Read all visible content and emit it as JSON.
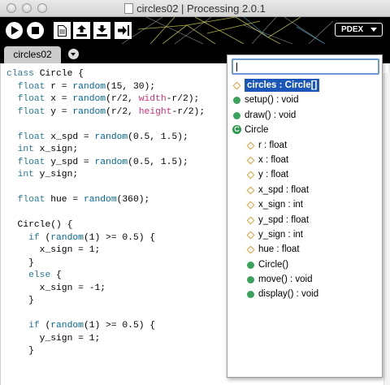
{
  "window": {
    "title": "circles02 | Processing 2.0.1"
  },
  "toolbar": {
    "mode_label": "PDEX"
  },
  "tabs": [
    {
      "label": "circles02"
    }
  ],
  "code": {
    "lines": [
      [
        [
          "class ",
          "kw"
        ],
        [
          "Circle {",
          ""
        ]
      ],
      [
        [
          "  ",
          ""
        ],
        [
          "float",
          "kw"
        ],
        [
          " r = ",
          ""
        ],
        [
          "random",
          "fn"
        ],
        [
          "(15, 30);",
          ""
        ]
      ],
      [
        [
          "  ",
          ""
        ],
        [
          "float",
          "kw"
        ],
        [
          " x = ",
          ""
        ],
        [
          "random",
          "fn"
        ],
        [
          "(r/2, ",
          ""
        ],
        [
          "width",
          "rd"
        ],
        [
          "-r/2);",
          ""
        ]
      ],
      [
        [
          "  ",
          ""
        ],
        [
          "float",
          "kw"
        ],
        [
          " y = ",
          ""
        ],
        [
          "random",
          "fn"
        ],
        [
          "(r/2, ",
          ""
        ],
        [
          "height",
          "rd"
        ],
        [
          "-r/2);",
          ""
        ]
      ],
      [
        [
          "",
          ""
        ]
      ],
      [
        [
          "  ",
          ""
        ],
        [
          "float",
          "kw"
        ],
        [
          " x_spd = ",
          ""
        ],
        [
          "random",
          "fn"
        ],
        [
          "(0.5, 1.5);",
          ""
        ]
      ],
      [
        [
          "  ",
          ""
        ],
        [
          "int",
          "kw"
        ],
        [
          " x_sign;",
          ""
        ]
      ],
      [
        [
          "  ",
          ""
        ],
        [
          "float",
          "kw"
        ],
        [
          " y_spd = ",
          ""
        ],
        [
          "random",
          "fn"
        ],
        [
          "(0.5, 1.5);",
          ""
        ]
      ],
      [
        [
          "  ",
          ""
        ],
        [
          "int",
          "kw"
        ],
        [
          " y_sign;",
          ""
        ]
      ],
      [
        [
          "",
          ""
        ]
      ],
      [
        [
          "  ",
          ""
        ],
        [
          "float",
          "kw"
        ],
        [
          " hue = ",
          ""
        ],
        [
          "random",
          "fn"
        ],
        [
          "(360);",
          ""
        ]
      ],
      [
        [
          "",
          ""
        ]
      ],
      [
        [
          "  Circle() {",
          ""
        ]
      ],
      [
        [
          "    ",
          ""
        ],
        [
          "if",
          "kw"
        ],
        [
          " (",
          ""
        ],
        [
          "random",
          "fn"
        ],
        [
          "(1) >= 0.5) {",
          ""
        ]
      ],
      [
        [
          "      x_sign = 1;",
          ""
        ]
      ],
      [
        [
          "    }",
          ""
        ]
      ],
      [
        [
          "    ",
          ""
        ],
        [
          "else",
          "kw"
        ],
        [
          " {",
          ""
        ]
      ],
      [
        [
          "      x_sign = -1;",
          ""
        ]
      ],
      [
        [
          "    }",
          ""
        ]
      ],
      [
        [
          "",
          ""
        ]
      ],
      [
        [
          "    ",
          ""
        ],
        [
          "if",
          "kw"
        ],
        [
          " (",
          ""
        ],
        [
          "random",
          "fn"
        ],
        [
          "(1) >= 0.5) {",
          ""
        ]
      ],
      [
        [
          "      y_sign = 1;",
          ""
        ]
      ],
      [
        [
          "    }",
          ""
        ]
      ]
    ]
  },
  "completion": {
    "input_value": "",
    "items": [
      {
        "label": "circles : Circle[]",
        "kind": "field-icon",
        "indent": 0,
        "selected": true
      },
      {
        "label": "setup() : void",
        "kind": "method-icon",
        "indent": 0
      },
      {
        "label": "draw() : void",
        "kind": "method-icon",
        "indent": 0
      },
      {
        "label": "Circle",
        "kind": "class-icon",
        "indent": 0
      },
      {
        "label": "r : float",
        "kind": "field-icon",
        "indent": 1
      },
      {
        "label": "x : float",
        "kind": "field-icon",
        "indent": 1
      },
      {
        "label": "y : float",
        "kind": "field-icon",
        "indent": 1
      },
      {
        "label": "x_spd : float",
        "kind": "field-icon",
        "indent": 1
      },
      {
        "label": "x_sign : int",
        "kind": "field-icon",
        "indent": 1
      },
      {
        "label": "y_spd : float",
        "kind": "field-icon",
        "indent": 1
      },
      {
        "label": "y_sign : int",
        "kind": "field-icon",
        "indent": 1
      },
      {
        "label": "hue : float",
        "kind": "field-icon",
        "indent": 1
      },
      {
        "label": "Circle()",
        "kind": "method-icon",
        "indent": 1
      },
      {
        "label": "move() : void",
        "kind": "method-icon",
        "indent": 1
      },
      {
        "label": "display() : void",
        "kind": "method-icon",
        "indent": 1
      }
    ]
  },
  "colors": {
    "selection": "#1a57b8",
    "keyword": "#2c7a96",
    "builtin_var": "#d2326e",
    "field_icon": "#d7a23d",
    "method_icon": "#3aa35a"
  }
}
